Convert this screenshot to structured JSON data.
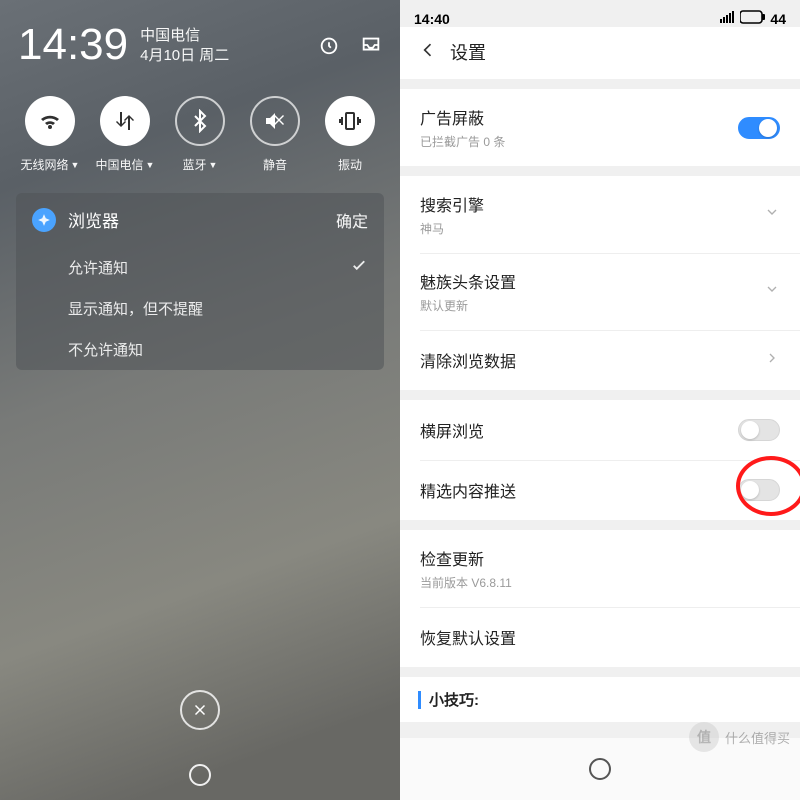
{
  "left": {
    "clock": "14:39",
    "carrier": "中国电信",
    "date": "4月10日 周二",
    "quick": [
      {
        "label": "无线网络",
        "dd": true,
        "on": true,
        "icon": "wifi"
      },
      {
        "label": "中国电信",
        "dd": true,
        "on": true,
        "icon": "data"
      },
      {
        "label": "蓝牙",
        "dd": true,
        "on": false,
        "icon": "bluetooth"
      },
      {
        "label": "静音",
        "dd": false,
        "on": false,
        "icon": "mute"
      },
      {
        "label": "振动",
        "dd": false,
        "on": true,
        "icon": "vibrate"
      }
    ],
    "notif": {
      "app": "浏览器",
      "confirm": "确定",
      "options": [
        {
          "label": "允许通知",
          "checked": true
        },
        {
          "label": "显示通知，但不提醒",
          "checked": false
        },
        {
          "label": "不允许通知",
          "checked": false
        }
      ]
    }
  },
  "right": {
    "status": {
      "time": "14:40",
      "battery": "44"
    },
    "header": {
      "title": "设置"
    },
    "rows": {
      "adblock": {
        "title": "广告屏蔽",
        "sub": "已拦截广告 0 条"
      },
      "search": {
        "title": "搜索引擎",
        "sub": "神马"
      },
      "headlines": {
        "title": "魅族头条设置",
        "sub": "默认更新"
      },
      "cleardata": {
        "title": "清除浏览数据"
      },
      "landscape": {
        "title": "横屏浏览"
      },
      "push": {
        "title": "精选内容推送"
      },
      "update": {
        "title": "检查更新",
        "sub": "当前版本 V6.8.11"
      },
      "restore": {
        "title": "恢复默认设置"
      }
    },
    "tip": "小技巧:",
    "watermark": "什么值得买"
  }
}
